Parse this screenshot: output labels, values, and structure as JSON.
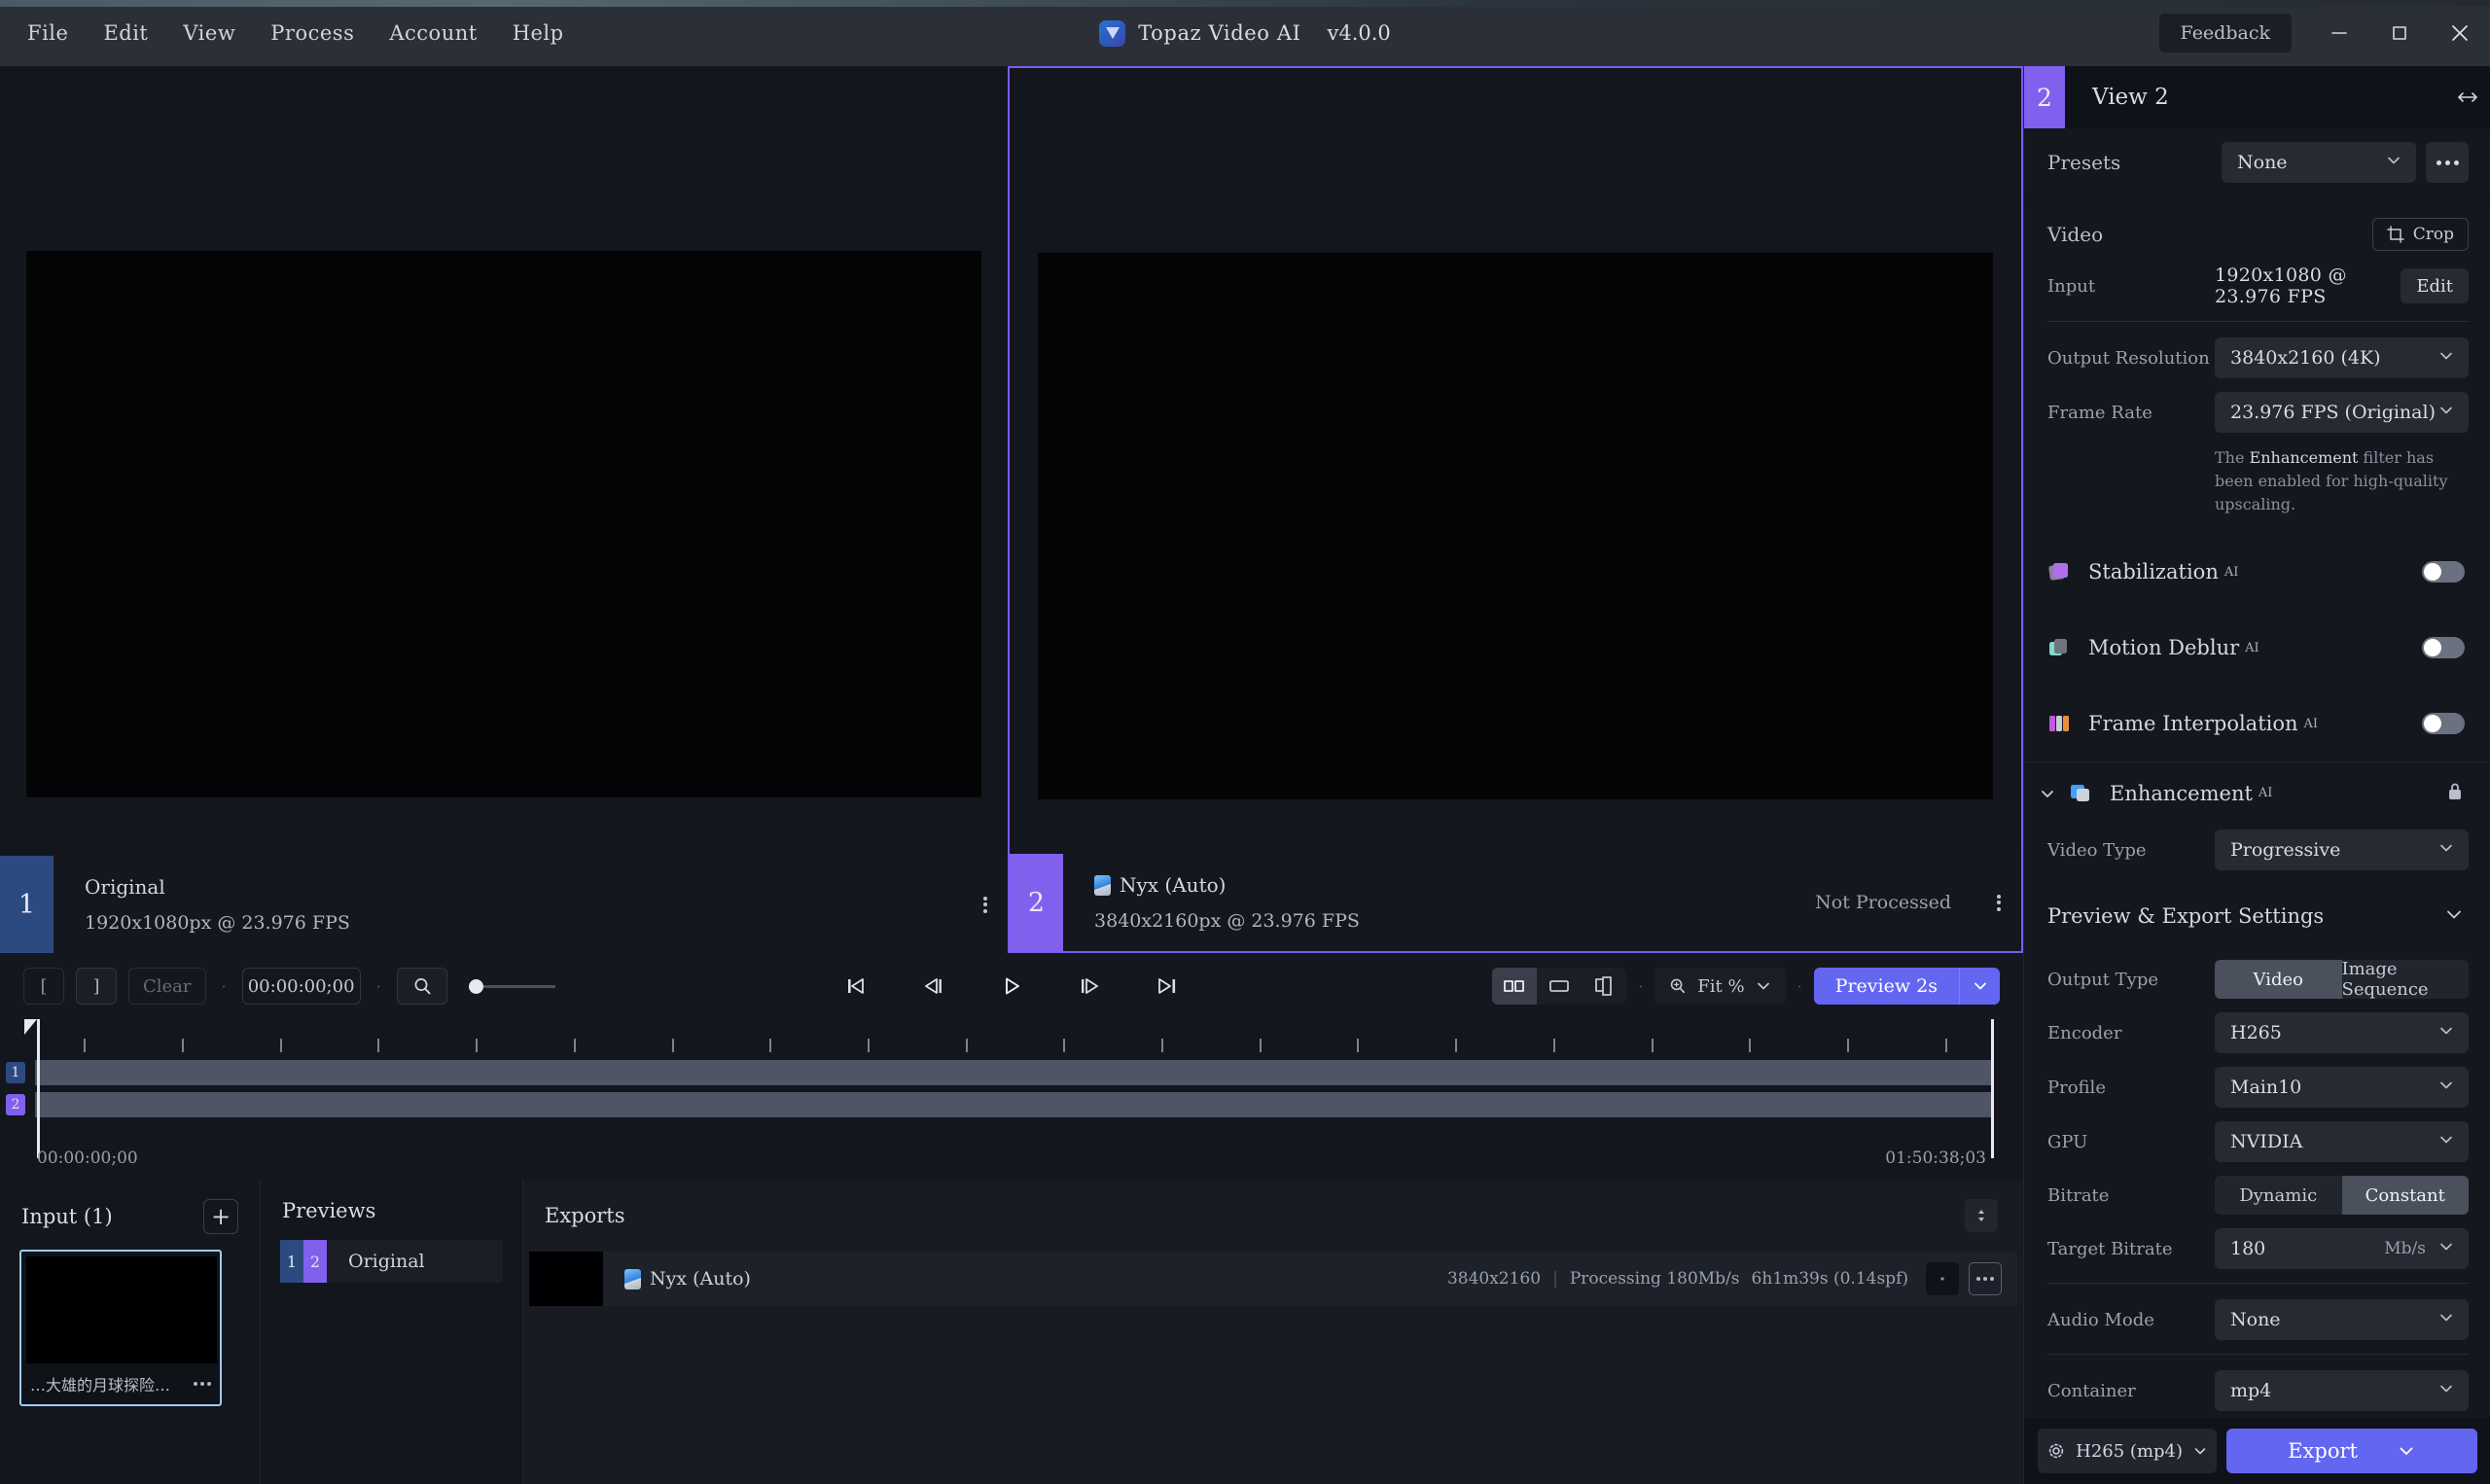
{
  "titlebar": {
    "menus": [
      "File",
      "Edit",
      "View",
      "Process",
      "Account",
      "Help"
    ],
    "app_name": "Topaz Video AI",
    "version": "v4.0.0",
    "feedback": "Feedback",
    "logo_icon": "topaz-logo-icon",
    "minimize_icon": "minimize-icon",
    "maximize_icon": "maximize-icon",
    "close_icon": "close-icon"
  },
  "viewers": [
    {
      "index": "1",
      "title": "Original",
      "subtitle": "1920x1080px @ 23.976 FPS",
      "status": ""
    },
    {
      "index": "2",
      "title": "Nyx (Auto)",
      "subtitle": "3840x2160px @ 23.976 FPS",
      "status": "Not Processed"
    }
  ],
  "transport": {
    "in_point": "[",
    "out_point": "]",
    "clear": "Clear",
    "timecode": "00:00:00;00",
    "search_icon": "magnifier-icon",
    "skip_start_icon": "skip-to-start-icon",
    "step_back_icon": "step-back-icon",
    "play_icon": "play-icon",
    "step_forward_icon": "step-forward-icon",
    "skip_end_icon": "skip-to-end-icon",
    "layout_split_icon": "layout-side-by-side-icon",
    "layout_single_icon": "layout-single-icon",
    "layout_split_vertical_icon": "layout-split-compare-icon",
    "zoom_label": "Fit %",
    "preview_label": "Preview 2s",
    "preview_caret_icon": "chevron-down-icon"
  },
  "timeline": {
    "start_time": "00:00:00;00",
    "end_time": "01:50:38;03",
    "track_badges": [
      "1",
      "2"
    ]
  },
  "input_panel": {
    "title": "Input (1)",
    "add_icon": "plus-icon",
    "file_name": "…大雄的月球探险记.mkv",
    "more_icon": "more-dots-icon"
  },
  "previews_panel": {
    "title": "Previews",
    "rows": [
      {
        "badge_1": "1",
        "badge_2": "2",
        "label": "Original"
      }
    ]
  },
  "exports_panel": {
    "title": "Exports",
    "sort_icon": "sort-icon",
    "rows": [
      {
        "name": "Nyx (Auto)",
        "resolution": "3840x2160",
        "separator": "|",
        "status": "Processing 180Mb/s",
        "eta": "6h1m39s (0.14spf)",
        "more_icon": "more-dots-icon"
      }
    ]
  },
  "right_panel": {
    "badge": "2",
    "title": "View 2",
    "expand_icon": "expand-horizontal-icon",
    "presets": {
      "label": "Presets",
      "value": "None",
      "more_icon": "more-dots-icon"
    },
    "video": {
      "title": "Video",
      "crop_label": "Crop",
      "crop_icon": "crop-icon",
      "input_label": "Input",
      "input_value": "1920x1080 @ 23.976 FPS",
      "edit_label": "Edit",
      "output_resolution_label": "Output Resolution",
      "output_resolution_value": "3840x2160 (4K)",
      "frame_rate_label": "Frame Rate",
      "frame_rate_value": "23.976 FPS (Original)",
      "note_prefix": "The ",
      "note_bold": "Enhancement",
      "note_suffix": " filter has been enabled for high-quality upscaling."
    },
    "filters": [
      {
        "name": "Stabilization",
        "ai": "AI",
        "enabled": false,
        "icon": "stabilization-icon"
      },
      {
        "name": "Motion Deblur",
        "ai": "AI",
        "enabled": false,
        "icon": "motion-deblur-icon"
      },
      {
        "name": "Frame Interpolation",
        "ai": "AI",
        "enabled": false,
        "icon": "frame-interpolation-icon"
      }
    ],
    "enhancement": {
      "name": "Enhancement",
      "ai": "AI",
      "chevron_icon": "chevron-down-icon",
      "lock_icon": "lock-icon",
      "video_type_label": "Video Type",
      "video_type_value": "Progressive"
    },
    "export_settings": {
      "title": "Preview & Export Settings",
      "chevron_icon": "chevron-down-icon",
      "output_type_label": "Output Type",
      "output_type_options": [
        "Video",
        "Image Sequence"
      ],
      "output_type_selected": "Video",
      "encoder_label": "Encoder",
      "encoder_value": "H265",
      "profile_label": "Profile",
      "profile_value": "Main10",
      "gpu_label": "GPU",
      "gpu_value": "NVIDIA",
      "bitrate_label": "Bitrate",
      "bitrate_options": [
        "Dynamic",
        "Constant"
      ],
      "bitrate_selected": "Constant",
      "target_bitrate_label": "Target Bitrate",
      "target_bitrate_value": "180",
      "target_bitrate_unit": "Mb/s",
      "audio_mode_label": "Audio Mode",
      "audio_mode_value": "None",
      "container_label": "Container",
      "container_value": "mp4"
    },
    "footer": {
      "codec_label": "H265 (mp4)",
      "gear_icon": "gear-icon",
      "export_label": "Export",
      "export_caret_icon": "chevron-down-icon"
    }
  },
  "colors": {
    "accent_purple": "#6366f1",
    "badge_purple": "#8160ee",
    "badge_blue": "#2d4a80",
    "panel_bg": "#14161d",
    "selection_blue": "#9fc9f5"
  }
}
